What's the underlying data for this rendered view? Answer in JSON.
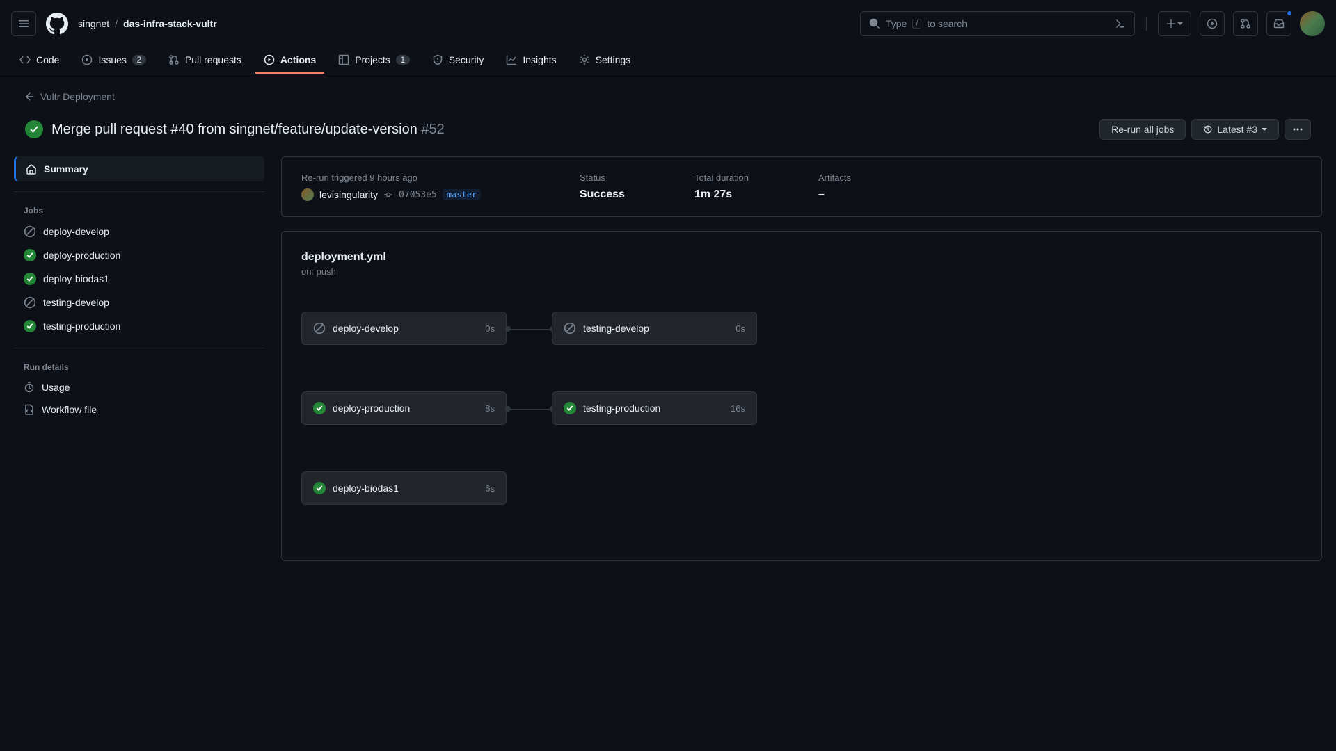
{
  "header": {
    "owner": "singnet",
    "repo": "das-infra-stack-vultr",
    "search_prefix": "Type",
    "search_key": "/",
    "search_suffix": "to search"
  },
  "repo_nav": {
    "code": "Code",
    "issues": "Issues",
    "issues_count": "2",
    "pulls": "Pull requests",
    "actions": "Actions",
    "projects": "Projects",
    "projects_count": "1",
    "security": "Security",
    "insights": "Insights",
    "settings": "Settings"
  },
  "back_link": "Vultr Deployment",
  "run": {
    "title": "Merge pull request #40 from singnet/feature/update-version",
    "number": "#52",
    "rerun_btn": "Re-run all jobs",
    "latest_btn": "Latest #3"
  },
  "sidebar": {
    "summary": "Summary",
    "jobs_heading": "Jobs",
    "jobs": [
      {
        "name": "deploy-develop",
        "status": "skip"
      },
      {
        "name": "deploy-production",
        "status": "success"
      },
      {
        "name": "deploy-biodas1",
        "status": "success"
      },
      {
        "name": "testing-develop",
        "status": "skip"
      },
      {
        "name": "testing-production",
        "status": "success"
      }
    ],
    "rundetails_heading": "Run details",
    "usage": "Usage",
    "workflow_file": "Workflow file"
  },
  "info": {
    "trigger_label": "Re-run triggered 9 hours ago",
    "actor": "levisingularity",
    "sha": "07053e5",
    "branch": "master",
    "status_label": "Status",
    "status_value": "Success",
    "duration_label": "Total duration",
    "duration_value": "1m 27s",
    "artifacts_label": "Artifacts",
    "artifacts_value": "–"
  },
  "workflow": {
    "file": "deployment.yml",
    "on": "on: push",
    "jobs": {
      "deploy_develop": {
        "name": "deploy-develop",
        "dur": "0s"
      },
      "testing_develop": {
        "name": "testing-develop",
        "dur": "0s"
      },
      "deploy_production": {
        "name": "deploy-production",
        "dur": "8s"
      },
      "testing_production": {
        "name": "testing-production",
        "dur": "16s"
      },
      "deploy_biodas1": {
        "name": "deploy-biodas1",
        "dur": "6s"
      }
    }
  }
}
